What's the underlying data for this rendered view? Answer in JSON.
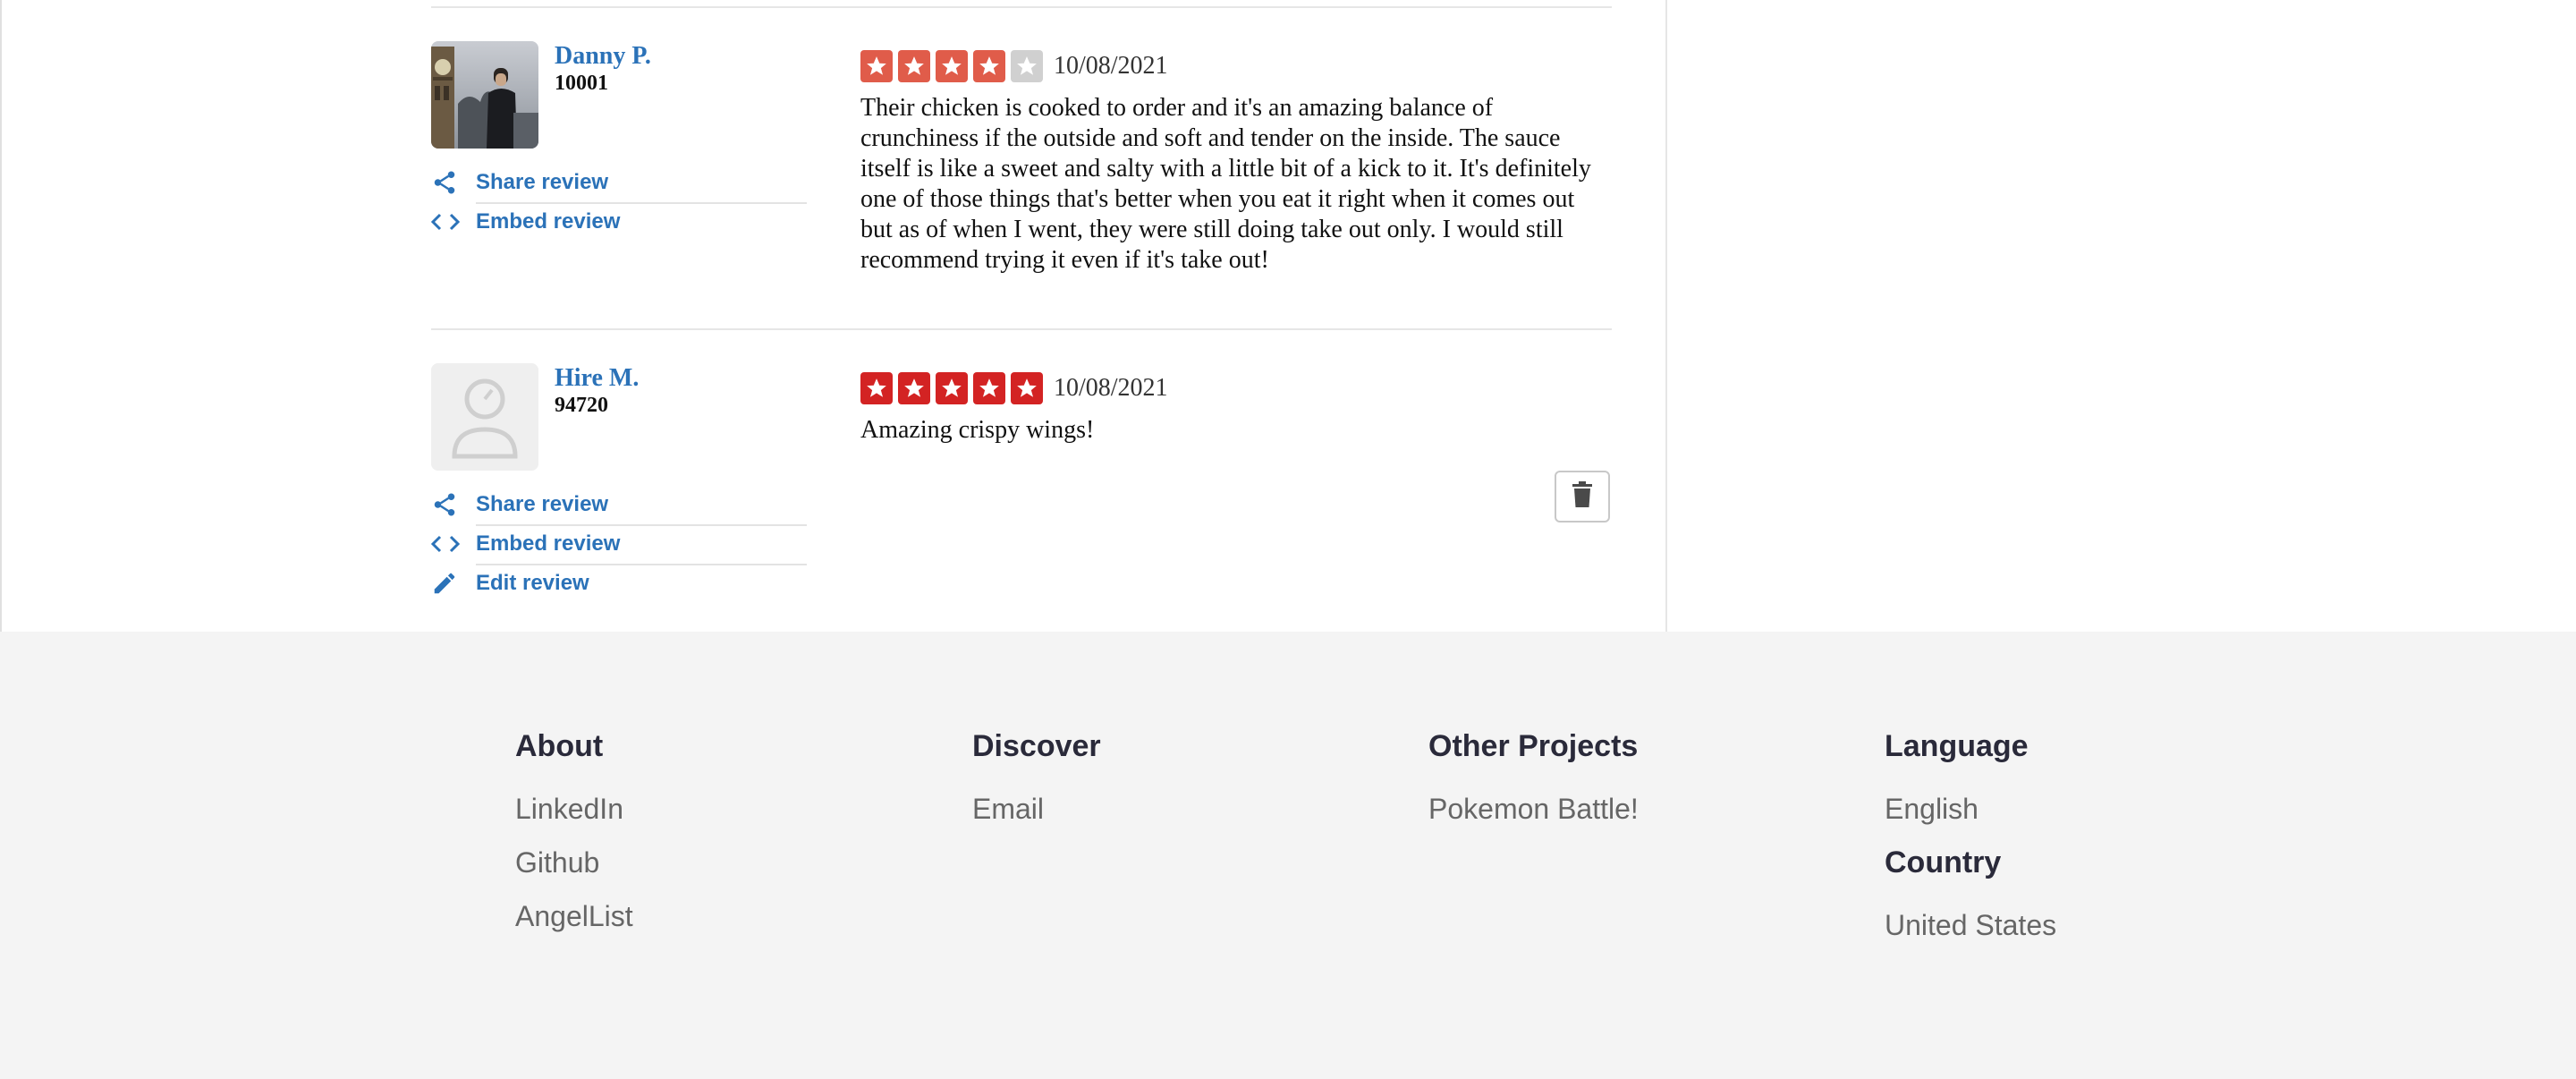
{
  "reviews": [
    {
      "user_name": "Danny P.",
      "user_zip": "10001",
      "rating": 4,
      "rating_max": 5,
      "rating_color": "#e05c4a",
      "date": "10/08/2021",
      "text": "Their chicken is cooked to order and it's an amazing balance of crunchiness if the outside and soft and tender on the inside. The sauce itself is like a sweet and salty with a little bit of a kick to it. It's definitely one of those things that's better when you eat it right when it comes out but as of when I went, they were still doing take out only. I would still recommend trying it even if it's take out!",
      "actions": [
        "Share review",
        "Embed review"
      ]
    },
    {
      "user_name": "Hire M.",
      "user_zip": "94720",
      "rating": 5,
      "rating_max": 5,
      "rating_color": "#d32323",
      "date": "10/08/2021",
      "text": "Amazing crispy wings!",
      "actions": [
        "Share review",
        "Embed review",
        "Edit review"
      ]
    }
  ],
  "footer": {
    "about": {
      "heading": "About",
      "links": [
        "LinkedIn",
        "Github",
        "AngelList"
      ]
    },
    "discover": {
      "heading": "Discover",
      "links": [
        "Email"
      ]
    },
    "other_projects": {
      "heading": "Other Projects",
      "links": [
        "Pokemon Battle!"
      ]
    },
    "language": {
      "heading": "Language",
      "value": "English"
    },
    "country": {
      "heading": "Country",
      "value": "United States"
    }
  },
  "colors": {
    "link_blue": "#2b72b8",
    "star_empty": "#d0d0d0",
    "footer_bg": "#f4f4f4"
  }
}
